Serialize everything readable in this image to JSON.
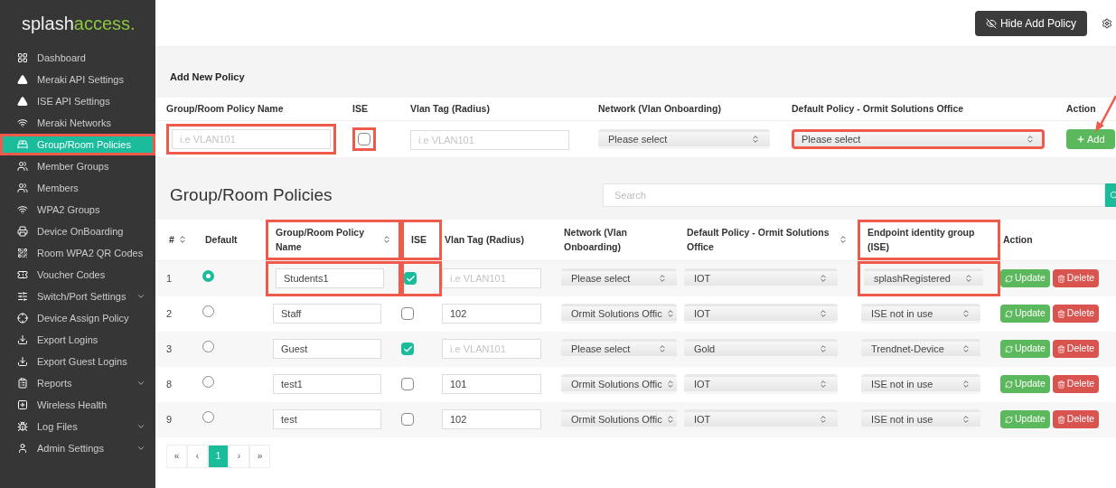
{
  "brand": {
    "first": "splash",
    "second": "access."
  },
  "sidebar": {
    "items": [
      {
        "label": "Dashboard",
        "selected": false,
        "highlighted": false,
        "has_submenu": false
      },
      {
        "label": "Meraki API Settings",
        "selected": false,
        "highlighted": false,
        "has_submenu": false
      },
      {
        "label": "ISE API Settings",
        "selected": false,
        "highlighted": false,
        "has_submenu": false
      },
      {
        "label": "Meraki Networks",
        "selected": false,
        "highlighted": false,
        "has_submenu": false
      },
      {
        "label": "Group/Room Policies",
        "selected": true,
        "highlighted": true,
        "has_submenu": false
      },
      {
        "label": "Member Groups",
        "selected": false,
        "highlighted": false,
        "has_submenu": false
      },
      {
        "label": "Members",
        "selected": false,
        "highlighted": false,
        "has_submenu": false
      },
      {
        "label": "WPA2 Groups",
        "selected": false,
        "highlighted": false,
        "has_submenu": false
      },
      {
        "label": "Device OnBoarding",
        "selected": false,
        "highlighted": false,
        "has_submenu": false
      },
      {
        "label": "Room WPA2 QR Codes",
        "selected": false,
        "highlighted": false,
        "has_submenu": false
      },
      {
        "label": "Voucher Codes",
        "selected": false,
        "highlighted": false,
        "has_submenu": false
      },
      {
        "label": "Switch/Port Settings",
        "selected": false,
        "highlighted": false,
        "has_submenu": true
      },
      {
        "label": "Device Assign Policy",
        "selected": false,
        "highlighted": false,
        "has_submenu": false
      },
      {
        "label": "Export Logins",
        "selected": false,
        "highlighted": false,
        "has_submenu": false
      },
      {
        "label": "Export Guest Logins",
        "selected": false,
        "highlighted": false,
        "has_submenu": false
      },
      {
        "label": "Reports",
        "selected": false,
        "highlighted": false,
        "has_submenu": true
      },
      {
        "label": "Wireless Health",
        "selected": false,
        "highlighted": false,
        "has_submenu": false
      },
      {
        "label": "Log Files",
        "selected": false,
        "highlighted": false,
        "has_submenu": true
      },
      {
        "label": "Admin Settings",
        "selected": false,
        "highlighted": false,
        "has_submenu": true
      }
    ]
  },
  "topbar": {
    "hide_button": "Hide Add Policy"
  },
  "add_form": {
    "title": "Add New Policy",
    "arrow": true,
    "fields": [
      {
        "kind": "text",
        "label": "Group/Room Policy Name",
        "placeholder": "i.e VLAN101",
        "highlighted": true
      },
      {
        "kind": "checkbox",
        "label": "ISE",
        "checked": false,
        "highlighted": true
      },
      {
        "kind": "text",
        "label": "Vlan Tag (Radius)",
        "placeholder": "i.e VLAN101",
        "highlighted": false
      },
      {
        "kind": "select",
        "label": "Network (Vlan Onboarding)",
        "value": "Please select",
        "highlighted": false
      },
      {
        "kind": "select",
        "label": "Default Policy - Ormit Solutions Office",
        "value": "Please select",
        "highlighted": true
      },
      {
        "kind": "button",
        "label": "Action",
        "value": "Add",
        "highlighted": false
      }
    ]
  },
  "policies": {
    "title": "Group/Room Policies",
    "search": {
      "placeholder": "Search"
    },
    "columns": [
      {
        "label": "#",
        "sortable": true,
        "highlighted": false
      },
      {
        "label": "Default",
        "sortable": false,
        "highlighted": false
      },
      {
        "label": "Group/Room Policy Name",
        "sortable": true,
        "highlighted": true
      },
      {
        "label": "ISE",
        "sortable": false,
        "highlighted": true
      },
      {
        "label": "Vlan Tag (Radius)",
        "sortable": false,
        "highlighted": false
      },
      {
        "label": "Network (Vlan Onboarding)",
        "sortable": false,
        "highlighted": false
      },
      {
        "label": "Default Policy - Ormit Solutions Office",
        "sortable": true,
        "highlighted": false
      },
      {
        "label": "Endpoint identity group (ISE)",
        "sortable": false,
        "highlighted": true
      },
      {
        "label": "Action",
        "sortable": false,
        "highlighted": false
      }
    ],
    "rows": [
      {
        "id": "1",
        "default": true,
        "name": "Students1",
        "ise": true,
        "vlan": {
          "placeholder": "i.e VLAN101"
        },
        "network": "Please select",
        "policy": "IOT",
        "endpoint": "splashRegistered",
        "actions": [
          "Update",
          "Delete"
        ]
      },
      {
        "id": "2",
        "default": false,
        "name": "Staff",
        "ise": false,
        "vlan": {
          "value": "102"
        },
        "network": "Ormit Solutions Offic",
        "policy": "IOT",
        "endpoint": "ISE not in use",
        "actions": [
          "Update",
          "Delete"
        ]
      },
      {
        "id": "3",
        "default": false,
        "name": "Guest",
        "ise": true,
        "vlan": {
          "placeholder": "i.e VLAN101"
        },
        "network": "Please select",
        "policy": "Gold",
        "endpoint": "Trendnet-Device",
        "actions": [
          "Update",
          "Delete"
        ]
      },
      {
        "id": "8",
        "default": false,
        "name": "test1",
        "ise": false,
        "vlan": {
          "value": "101"
        },
        "network": "Ormit Solutions Offic",
        "policy": "IOT",
        "endpoint": "ISE not in use",
        "actions": [
          "Update",
          "Delete"
        ]
      },
      {
        "id": "9",
        "default": false,
        "name": "test",
        "ise": false,
        "vlan": {
          "value": "102"
        },
        "network": "Ormit Solutions Offic",
        "policy": "IOT",
        "endpoint": "ISE not in use",
        "actions": [
          "Update",
          "Delete"
        ]
      }
    ],
    "pagination": [
      {
        "label": "«",
        "selected": false
      },
      {
        "label": "‹",
        "selected": false
      },
      {
        "label": "1",
        "selected": true
      },
      {
        "label": "›",
        "selected": false
      },
      {
        "label": "»",
        "selected": false
      }
    ]
  }
}
